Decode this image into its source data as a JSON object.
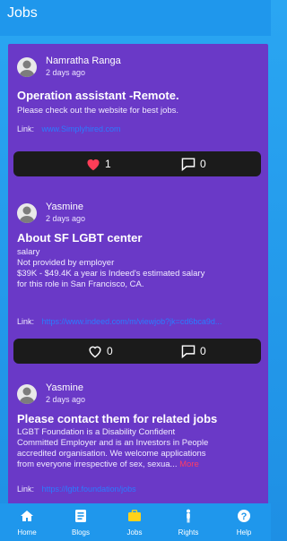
{
  "header": {
    "title": "Jobs"
  },
  "posts": [
    {
      "author": "Namratha Ranga",
      "time": "2 days ago",
      "title": "Operation assistant -Remote.",
      "body": "Please check out the website for best jobs.",
      "link_label": "Link:",
      "link_url": "www.Simplyhired.com",
      "likes": "1",
      "comments": "0",
      "liked": true
    },
    {
      "author": "Yasmine",
      "time": "2 days ago",
      "title": "About SF LGBT center",
      "body_lines": [
        "salary",
        "Not provided by employer",
        "$39K - $49.4K a year is Indeed's estimated salary",
        "for this role in San Francisco, CA."
      ],
      "link_label": "Link:",
      "link_url": "https://www.indeed.com/m/viewjob?jk=cd6bca9d...",
      "likes": "0",
      "comments": "0",
      "liked": false
    },
    {
      "author": "Yasmine",
      "time": "2 days ago",
      "title": "Please contact  them for related jobs",
      "body_lines": [
        "LGBT Foundation is a Disability Confident",
        "Committed Employer and is an Investors in People",
        "accredited organisation. We welcome applications",
        "from everyone irrespective of sex, sexua..."
      ],
      "more_label": "More",
      "link_label": "Link:",
      "link_url": "https://lgbt.foundation/jobs"
    }
  ],
  "nav": {
    "items": [
      {
        "label": "Home",
        "icon": "home-icon"
      },
      {
        "label": "Blogs",
        "icon": "blog-icon"
      },
      {
        "label": "Jobs",
        "icon": "briefcase-icon"
      },
      {
        "label": "Rights",
        "icon": "person-icon"
      },
      {
        "label": "Help",
        "icon": "help-icon"
      }
    ],
    "active": "Jobs"
  },
  "colors": {
    "header_bg": "#1f97ec",
    "card_bg": "#6a39c7",
    "action_bar_bg": "#1b1b1b",
    "like_heart": "#ff3d57",
    "link": "#2a7cff",
    "nav_active": "#ffd21a"
  }
}
